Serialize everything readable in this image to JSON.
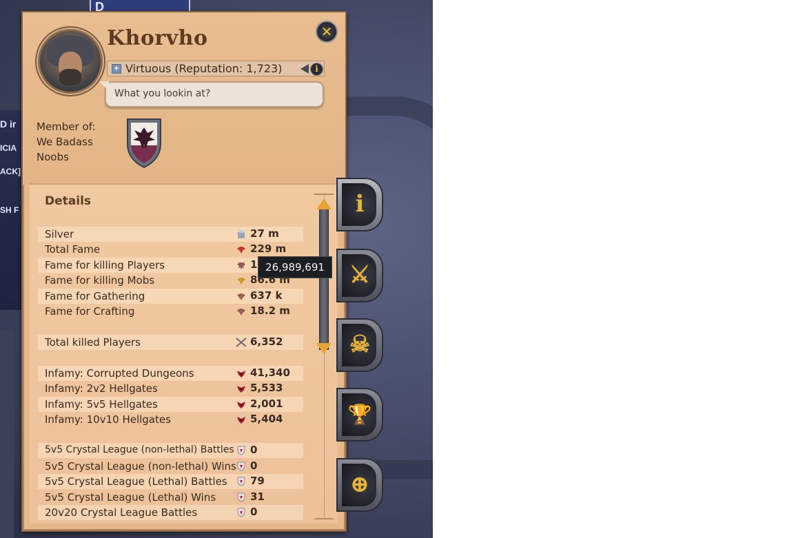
{
  "background": {
    "top_sign_text": "D",
    "left_strip_texts": [
      "D ir",
      "ICIA",
      "ACK]",
      "SH F"
    ]
  },
  "profile": {
    "name": "Khorvho",
    "reputation": "Virtuous (Reputation: 1,723)",
    "quote": "What you lookin at?",
    "member_of_label": "Member of:",
    "guild_name_line1": "We Badass",
    "guild_name_line2": "Noobs"
  },
  "details": {
    "title": "Details",
    "rows": [
      {
        "label": "Silver",
        "value": "27 m",
        "icon": "silver-icon"
      },
      {
        "label": "Total Fame",
        "value": "229 m",
        "icon": "fame-icon"
      },
      {
        "label": "Fame for killing Players",
        "value": "1",
        "icon": "pvp-fame-icon"
      },
      {
        "label": "Fame for killing Mobs",
        "value": "86.6 m",
        "icon": "pve-fame-icon"
      },
      {
        "label": "Fame for Gathering",
        "value": "637 k",
        "icon": "gathering-fame-icon"
      },
      {
        "label": "Fame for Crafting",
        "value": "18.2 m",
        "icon": "crafting-fame-icon"
      },
      {
        "label": "Total killed Players",
        "value": "6,352",
        "icon": "crossed-swords-icon"
      },
      {
        "label": "Infamy: Corrupted Dungeons",
        "value": "41,340",
        "icon": "infamy-icon"
      },
      {
        "label": "Infamy: 2v2 Hellgates",
        "value": "5,533",
        "icon": "infamy-icon"
      },
      {
        "label": "Infamy: 5v5 Hellgates",
        "value": "2,001",
        "icon": "infamy-icon"
      },
      {
        "label": "Infamy: 10v10 Hellgates",
        "value": "5,404",
        "icon": "infamy-icon"
      },
      {
        "label": "5v5 Crystal League (non-lethal) Battles",
        "value": "0",
        "icon": "crystal-league-icon"
      },
      {
        "label": "5v5 Crystal League (non-lethal) Wins",
        "value": "0",
        "icon": "crystal-league-icon"
      },
      {
        "label": "5v5 Crystal League (Lethal) Battles",
        "value": "79",
        "icon": "crystal-league-icon"
      },
      {
        "label": "5v5 Crystal League (Lethal) Wins",
        "value": "31",
        "icon": "crystal-league-icon"
      },
      {
        "label": "20v20 Crystal League Battles",
        "value": "0",
        "icon": "crystal-league-icon"
      }
    ]
  },
  "tooltip": {
    "text": "26,989,691"
  },
  "side_tabs": [
    {
      "name": "info-tab",
      "glyph": "i"
    },
    {
      "name": "combat-tab",
      "glyph": "⚔"
    },
    {
      "name": "kills-tab",
      "glyph": "☠"
    },
    {
      "name": "achievements-tab",
      "glyph": "🏆"
    },
    {
      "name": "guild-war-tab",
      "glyph": "⊕"
    }
  ],
  "colors": {
    "panel_bg": "#e6b98b",
    "accent_gold": "#e7a436",
    "text_dark": "#3a2a1f"
  }
}
